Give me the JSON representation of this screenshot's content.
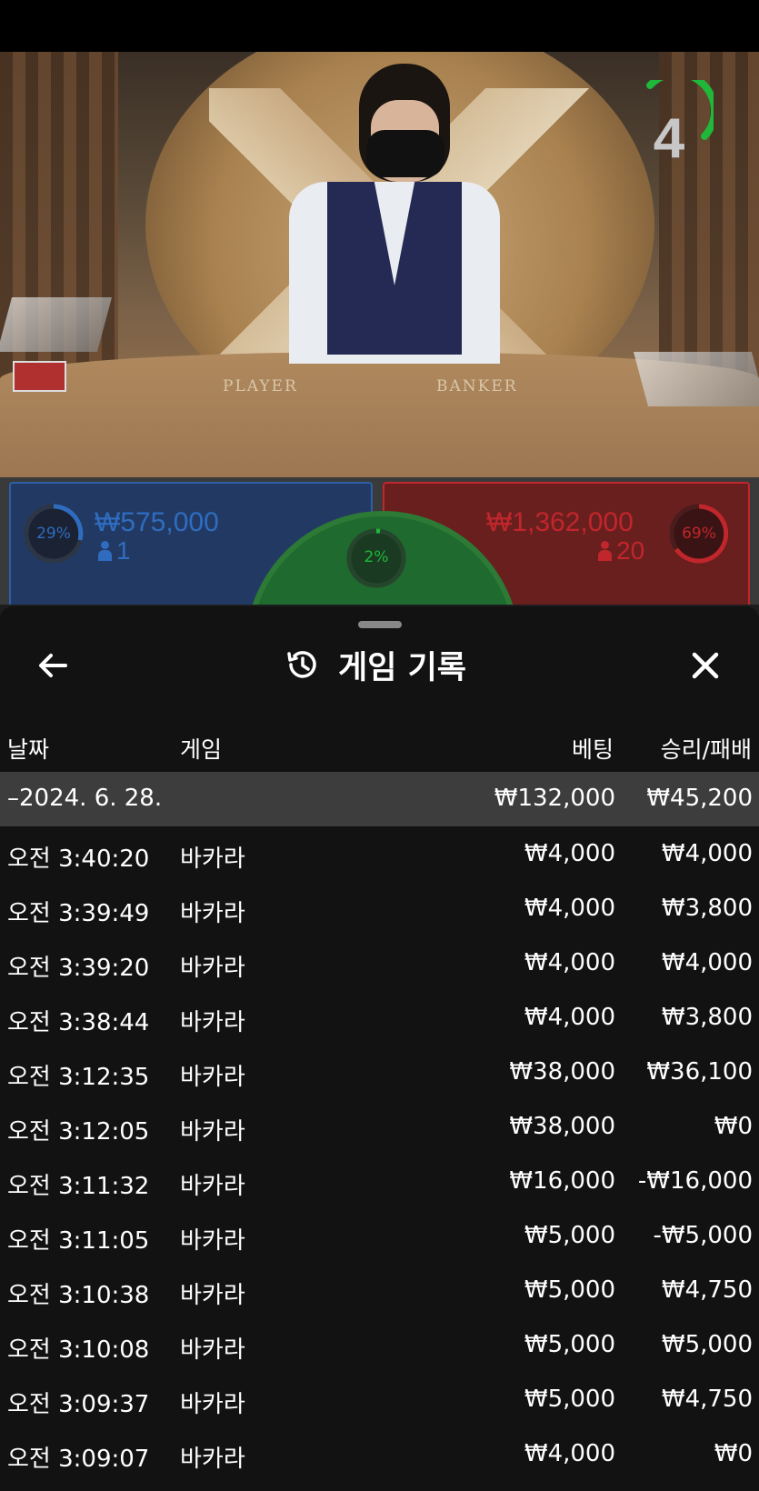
{
  "video": {
    "timer": "4",
    "table_player": "PLAYER",
    "table_banker": "BANKER"
  },
  "bets": {
    "player": {
      "percent": "29%",
      "amount": "₩575,000",
      "players": "1"
    },
    "tie": {
      "percent": "2%"
    },
    "banker": {
      "percent": "69%",
      "amount": "₩1,362,000",
      "players": "20"
    }
  },
  "colors": {
    "player": "#2f6cc0",
    "banker": "#c0262b",
    "tie": "#2c7a35",
    "timer": "#1fb83a"
  },
  "sheet": {
    "title": "게임 기록",
    "back_icon": "arrow-left-icon",
    "history_icon": "history-icon",
    "close_icon": "close-icon",
    "columns": {
      "date": "날짜",
      "game": "게임",
      "bet": "베팅",
      "result": "승리/패배"
    },
    "summary": {
      "date": "–2024. 6. 28.",
      "bet": "₩132,000",
      "result": "₩45,200"
    },
    "rows": [
      {
        "time": "오전 3:40:20",
        "game": "바카라",
        "bet": "₩4,000",
        "result": "₩4,000"
      },
      {
        "time": "오전 3:39:49",
        "game": "바카라",
        "bet": "₩4,000",
        "result": "₩3,800"
      },
      {
        "time": "오전 3:39:20",
        "game": "바카라",
        "bet": "₩4,000",
        "result": "₩4,000"
      },
      {
        "time": "오전 3:38:44",
        "game": "바카라",
        "bet": "₩4,000",
        "result": "₩3,800"
      },
      {
        "time": "오전 3:12:35",
        "game": "바카라",
        "bet": "₩38,000",
        "result": "₩36,100"
      },
      {
        "time": "오전 3:12:05",
        "game": "바카라",
        "bet": "₩38,000",
        "result": "₩0"
      },
      {
        "time": "오전 3:11:32",
        "game": "바카라",
        "bet": "₩16,000",
        "result": "-₩16,000"
      },
      {
        "time": "오전 3:11:05",
        "game": "바카라",
        "bet": "₩5,000",
        "result": "-₩5,000"
      },
      {
        "time": "오전 3:10:38",
        "game": "바카라",
        "bet": "₩5,000",
        "result": "₩4,750"
      },
      {
        "time": "오전 3:10:08",
        "game": "바카라",
        "bet": "₩5,000",
        "result": "₩5,000"
      },
      {
        "time": "오전 3:09:37",
        "game": "바카라",
        "bet": "₩5,000",
        "result": "₩4,750"
      },
      {
        "time": "오전 3:09:07",
        "game": "바카라",
        "bet": "₩4,000",
        "result": "₩0"
      }
    ]
  }
}
